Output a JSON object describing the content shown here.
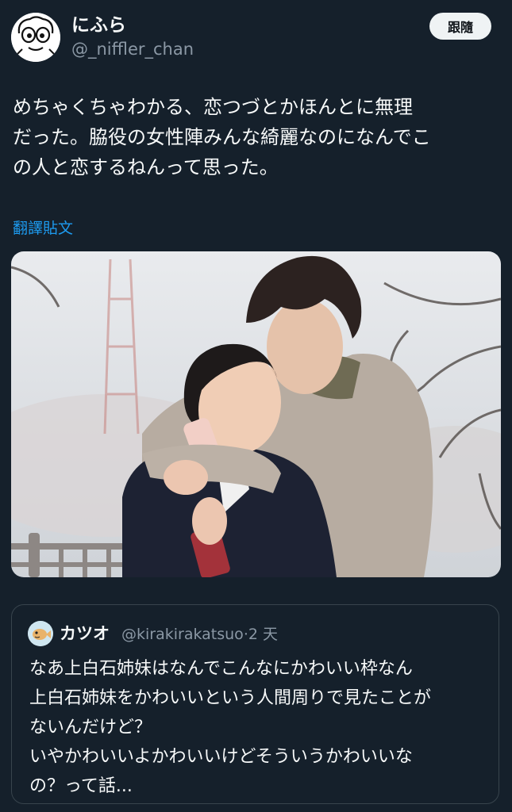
{
  "tweet": {
    "author": {
      "display_name": "にふら",
      "handle": "@_niffler_chan",
      "avatar_icon": "doodle-face-avatar"
    },
    "follow_label": "跟隨",
    "text_lines": [
      "めちゃくちゃわかる、恋つづとかほんとに無理",
      "だった。脇役の女性陣みんな綺麗なのになんでこ",
      "の人と恋するねんって思った。"
    ],
    "translate_label": "翻譯貼文",
    "media": {
      "type": "photo"
    }
  },
  "quote": {
    "author": {
      "display_name": "カツオ",
      "handle": "@kirakirakatsuo",
      "avatar_icon": "fish-avatar"
    },
    "separator": "·",
    "time": "2 天",
    "text_lines": [
      "なあ上白石姉妹はなんでこんなにかわいい枠なん",
      "上白石姉妹をかわいいという人間周りで見たことが",
      "ないんだけど？",
      "いやかわいいよかわいいけどそういうかわいいな",
      "の？って話..."
    ]
  },
  "colors": {
    "background": "#15202b",
    "text_primary": "#f7f9f9",
    "text_secondary": "#8b98a5",
    "link": "#1d9bf0",
    "border": "#38444d",
    "button_bg": "#eff3f4"
  }
}
